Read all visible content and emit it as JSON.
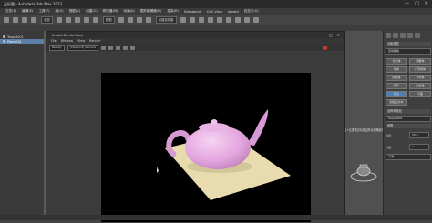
{
  "app": {
    "title": "无标题 - Autodesk 3ds Max 2023",
    "window_controls": [
      "—",
      "□",
      "✕"
    ]
  },
  "menubar": [
    "文件(F)",
    "编辑(E)",
    "工具(T)",
    "组(G)",
    "视图(V)",
    "创建(C)",
    "修改器(M)",
    "动画(A)",
    "图形编辑器(D)",
    "渲染(R)",
    "Substance",
    "Civil View",
    "Arnold",
    "自定义(U)"
  ],
  "toolbar": {
    "selection_filter": "全部",
    "view_combo": "视图",
    "selection_set": "创建选择集"
  },
  "scene_explorer": {
    "items": [
      {
        "label": "Teapot001",
        "selected": false
      },
      {
        "label": "Plane001",
        "selected": true
      }
    ]
  },
  "render_view": {
    "title": "Arnold RenderView",
    "menu": [
      "File",
      "Window",
      "View",
      "Render"
    ],
    "camera_combo": "Beauty",
    "view_combo": "[Viewport] Camera"
  },
  "viewport": {
    "right_label": "[+][透视][标准][默认明暗处理]"
  },
  "command_panel": {
    "rollout_object_type": "对象类型",
    "auto_grid": "自动栅格",
    "buttons": [
      "长方体",
      "圆锥体",
      "球体",
      "几何球体",
      "圆柱体",
      "管状体",
      "圆环",
      "四棱锥",
      "茶壶",
      "平面",
      "加强型文本"
    ],
    "active_button": "茶壶",
    "rollout_name_color": "名称和颜色",
    "name_value": "Teapot001",
    "rollout_params": "参数",
    "radius_label": "半径:",
    "radius_value": "35.0",
    "segments_label": "分段:",
    "segments_value": "4",
    "smooth_label": "平滑"
  },
  "colors": {
    "accent": "#4d7fb0",
    "teapot": "#e4a6df",
    "plane": "#e8dcae",
    "render_bg": "#000000",
    "stop": "#c0392b"
  }
}
